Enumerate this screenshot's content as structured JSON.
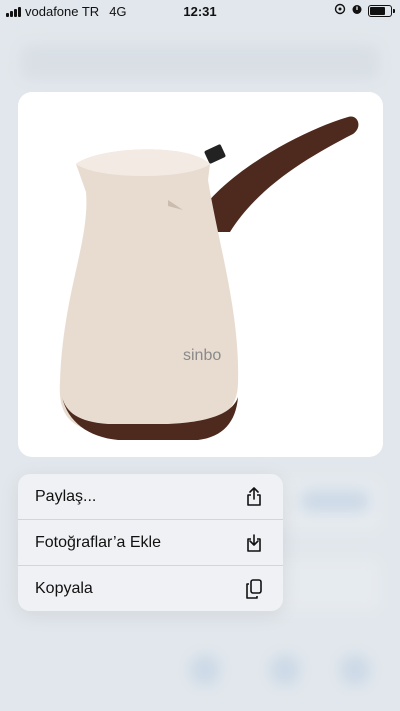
{
  "status_bar": {
    "carrier": "vodafone TR",
    "network": "4G",
    "time": "12:31",
    "icons": [
      "location-icon",
      "alarm-icon",
      "battery-icon"
    ]
  },
  "preview": {
    "brand_label": "sinbo",
    "icon": "coffee-pot-image"
  },
  "context_menu": {
    "items": [
      {
        "label": "Paylaş...",
        "icon": "share-icon"
      },
      {
        "label": "Fotoğraflar’a Ekle",
        "icon": "save-to-photos-icon"
      },
      {
        "label": "Kopyala",
        "icon": "copy-icon"
      }
    ]
  }
}
